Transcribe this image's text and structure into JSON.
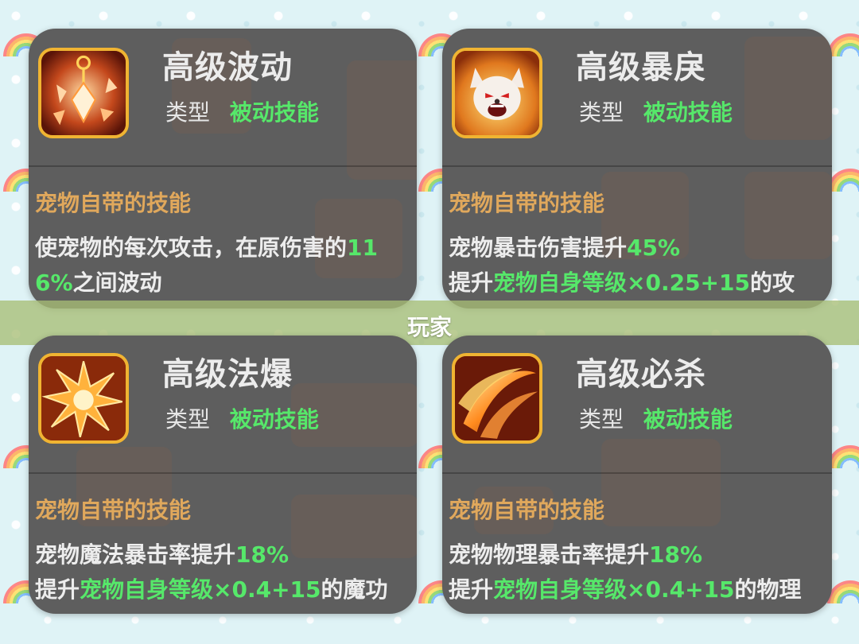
{
  "banner": {
    "text": "玩家"
  },
  "colors": {
    "card_bg": "#5e5e5e",
    "highlight_green": "#56e86a",
    "section_orange": "#e0a85c",
    "icon_border": "#f0b432"
  },
  "cards": [
    {
      "icon": "crystal-pendulum-icon",
      "title": "高级波动",
      "type_label": "类型",
      "type_value": "被动技能",
      "section": "宠物自带的技能",
      "line1": {
        "a": "使宠物的每次攻击，在原伤害的",
        "b": "11",
        "c": ""
      },
      "line2": {
        "a": "",
        "b": "6%",
        "c": "之间波动"
      }
    },
    {
      "icon": "angry-wolf-icon",
      "title": "高级暴戾",
      "type_label": "类型",
      "type_value": "被动技能",
      "section": "宠物自带的技能",
      "line1": {
        "a": "宠物暴击伤害提升",
        "b": "45%",
        "c": ""
      },
      "line2": {
        "a": "提升",
        "b": "宠物自身等级×0.25+15",
        "c": "的攻"
      }
    },
    {
      "icon": "magic-burst-icon",
      "title": "高级法爆",
      "type_label": "类型",
      "type_value": "被动技能",
      "section": "宠物自带的技能",
      "line1": {
        "a": "宠物魔法暴击率提升",
        "b": "18%",
        "c": ""
      },
      "line2": {
        "a": "提升",
        "b": "宠物自身等级×0.4+15",
        "c": "的魔功"
      }
    },
    {
      "icon": "fire-slash-icon",
      "title": "高级必杀",
      "type_label": "类型",
      "type_value": "被动技能",
      "section": "宠物自带的技能",
      "line1": {
        "a": "宠物物理暴击率提升",
        "b": "18%",
        "c": ""
      },
      "line2": {
        "a": "提升",
        "b": "宠物自身等级×0.4+15",
        "c": "的物理"
      }
    }
  ]
}
